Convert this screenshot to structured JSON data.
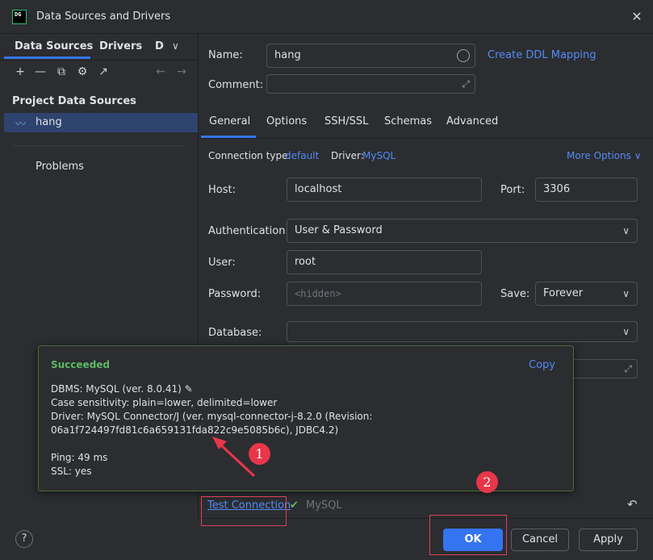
{
  "window": {
    "title": "Data Sources and Drivers",
    "app_icon_text": "DG",
    "close_glyph": "✕"
  },
  "left": {
    "tabs": [
      "Data Sources",
      "Drivers",
      "DI"
    ],
    "section_title": "Project Data Sources",
    "data_source": "hang",
    "problems": "Problems"
  },
  "form": {
    "name_label": "Name:",
    "name_value": "hang",
    "create_ddl": "Create DDL Mapping",
    "comment_label": "Comment:",
    "tabs": [
      "General",
      "Options",
      "SSH/SSL",
      "Schemas",
      "Advanced"
    ],
    "conn_type_label": "Connection type:",
    "conn_type_value": "default",
    "driver_label": "Driver:",
    "driver_value": "MySQL",
    "more_options": "More Options",
    "host_label": "Host:",
    "host_value": "localhost",
    "port_label": "Port:",
    "port_value": "3306",
    "auth_label": "Authentication:",
    "auth_value": "User & Password",
    "user_label": "User:",
    "user_value": "root",
    "password_label": "Password:",
    "password_placeholder": "<hidden>",
    "save_label": "Save:",
    "save_value": "Forever",
    "database_label": "Database:"
  },
  "popup": {
    "title": "Succeeded",
    "copy": "Copy",
    "dbms": "DBMS: MySQL (ver. 8.0.41)",
    "case": "Case sensitivity: plain=lower, delimited=lower",
    "driver1": "Driver: MySQL Connector/J (ver. mysql-connector-j-8.2.0 (Revision:",
    "driver2": "06a1f724497fd81c6a659131fda822c9e5085b6c), JDBC4.2)",
    "ping": "Ping: 49 ms",
    "ssl": "SSL: yes"
  },
  "bottom": {
    "test_connection": "Test Connection",
    "status_driver": "MySQL",
    "ok": "OK",
    "cancel": "Cancel",
    "apply": "Apply",
    "help": "?"
  },
  "annotations": {
    "marker1": "1",
    "marker2": "2",
    "color": "#e8364a"
  },
  "colors": {
    "accent": "#3574f0",
    "link": "#548af7",
    "success": "#5fb865",
    "background": "#2b2d30"
  }
}
